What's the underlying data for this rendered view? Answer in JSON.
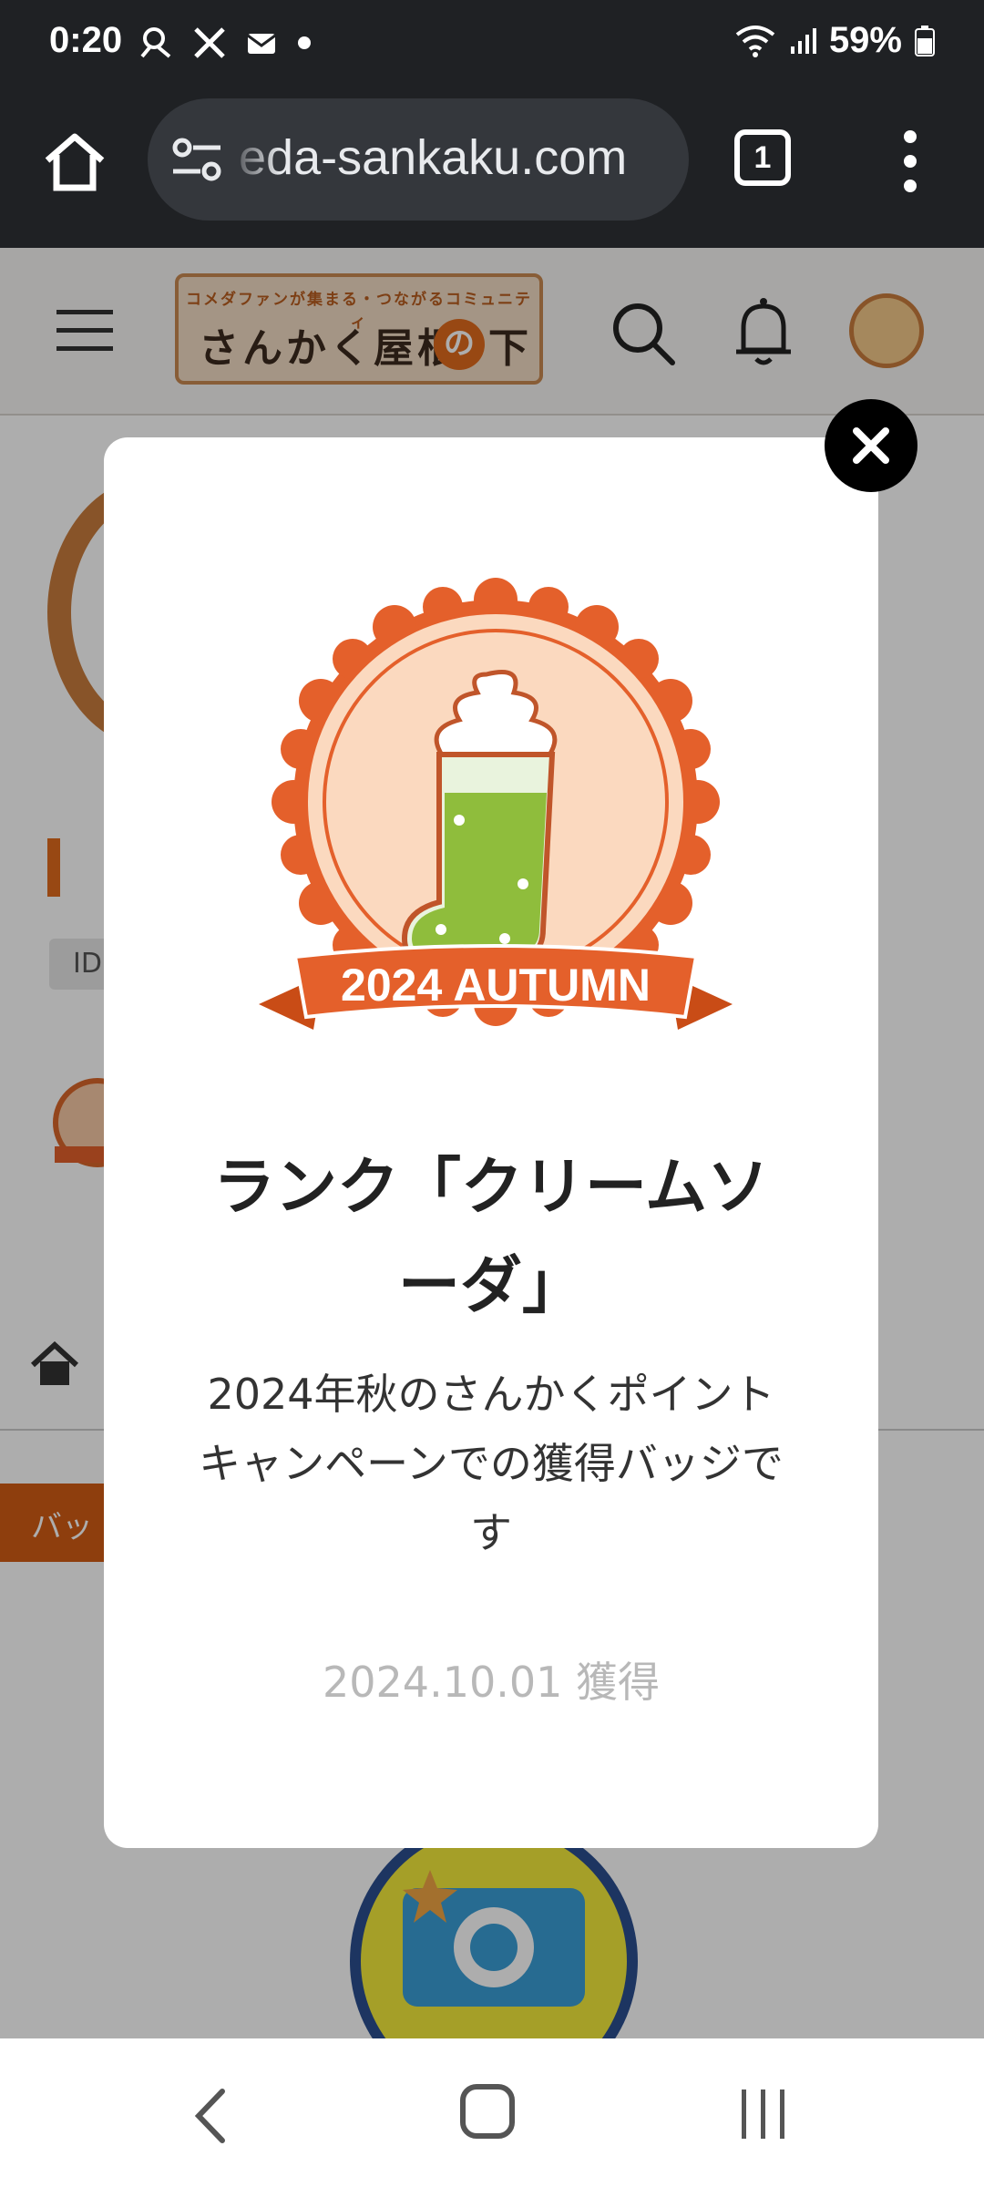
{
  "status_bar": {
    "time": "0:20",
    "battery_percent": "59%"
  },
  "browser": {
    "url": "eda-sankaku.com",
    "tab_count": "1"
  },
  "site": {
    "logo_tagline": "コメダファンが集まる・つながるコミュニティ",
    "logo_main": "さんかく屋根",
    "logo_circle": "の",
    "logo_tail": "下",
    "id_label": "ID",
    "badge_tab_label": "バッ"
  },
  "modal": {
    "badge_ribbon_text": "2024 AUTUMN",
    "title": "ランク「クリームソーダ」",
    "description": "2024年秋のさんかくポイントキャンペーンでの獲得バッジです",
    "acquired_date": "2024.10.01 獲得"
  },
  "colors": {
    "accent_orange": "#e06a1c",
    "brand_brown": "#c97d3d",
    "dark_bar": "#1f2124"
  }
}
